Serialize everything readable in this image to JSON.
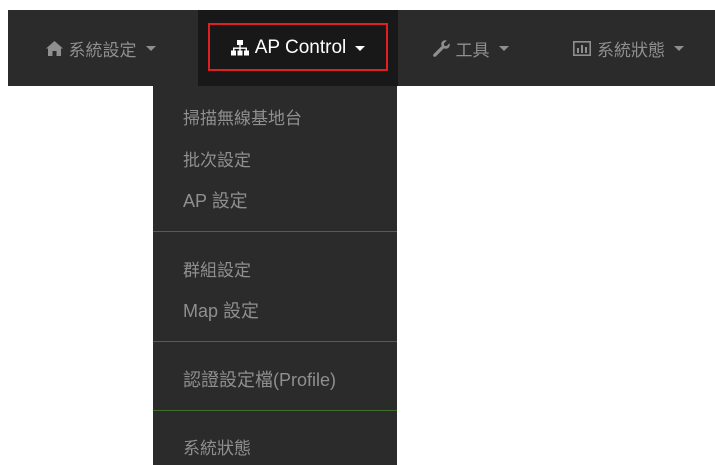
{
  "nav": {
    "items": [
      {
        "label": "系統設定",
        "icon": "home-icon"
      },
      {
        "label": "AP Control",
        "icon": "sitemap-icon"
      },
      {
        "label": "工具",
        "icon": "wrench-icon"
      },
      {
        "label": "系統狀態",
        "icon": "bar-chart-icon"
      }
    ],
    "active_index": 1
  },
  "dropdown": {
    "groups": [
      [
        "掃描無線基地台",
        "批次設定",
        "AP 設定"
      ],
      [
        "群組設定",
        "Map 設定"
      ],
      [
        "認證設定檔(Profile)"
      ],
      [
        "系統狀態"
      ]
    ]
  },
  "colors": {
    "navbar_bg": "#2b2b2b",
    "active_bg": "#181818",
    "highlight_border": "#e02020",
    "divider": "#3f6f2a",
    "text_muted": "#8f8f8f",
    "text_active": "#ffffff"
  }
}
